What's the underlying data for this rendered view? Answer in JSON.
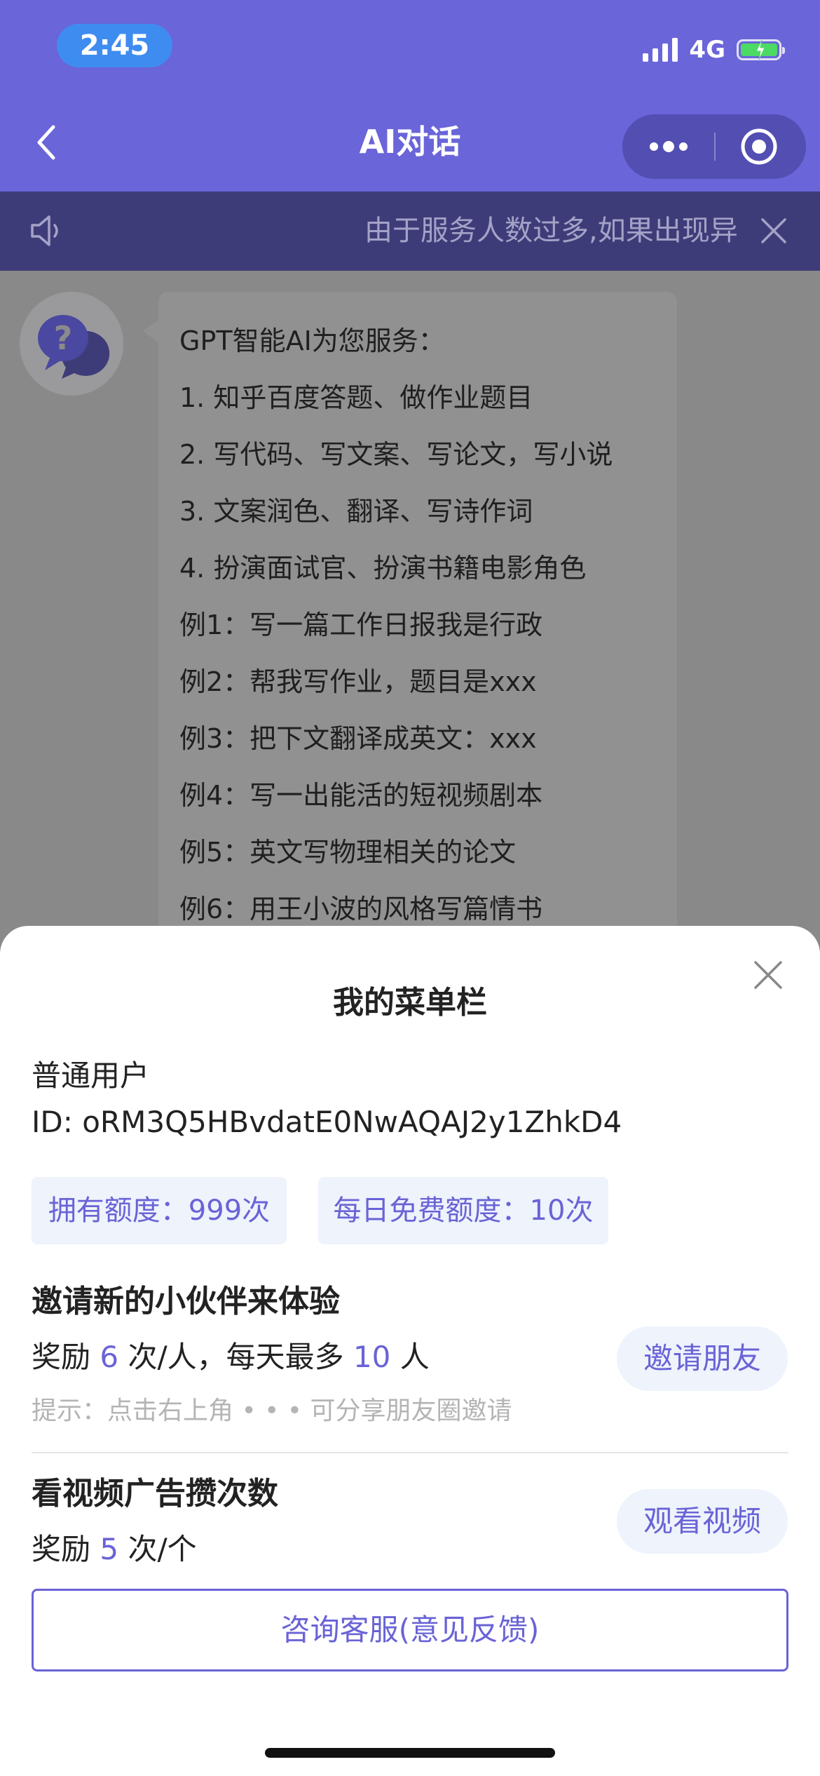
{
  "status_bar": {
    "time": "2:45",
    "network": "4G",
    "icons": [
      "signal-icon",
      "battery-charging-icon"
    ]
  },
  "navbar": {
    "title": "AI对话",
    "icons": [
      "back-icon",
      "more-icon",
      "target-icon"
    ]
  },
  "notice": {
    "text": "由于服务人数过多,如果出现异",
    "icons": [
      "speaker-icon",
      "close-icon"
    ]
  },
  "chat": {
    "messages": [
      {
        "sender": "bot",
        "avatar_icon": "question-chat-icon",
        "lines": [
          "GPT智能AI为您服务：",
          "1. 知乎百度答题、做作业题目",
          "2. 写代码、写文案、写论文，写小说",
          "3. 文案润色、翻译、写诗作词",
          "4. 扮演面试官、扮演书籍电影角色",
          "例1：写一篇工作日报我是行政",
          "例2：帮我写作业，题目是xxx",
          "例3：把下文翻译成英文：xxx",
          "例4：写一出能活的短视频剧本",
          "例5：英文写物理相关的论文",
          "例6：用王小波的风格写篇情书"
        ]
      }
    ]
  },
  "sheet": {
    "title": "我的菜单栏",
    "user_type": "普通用户",
    "user_id": "ID: oRM3Q5HBvdatE0NwAQAJ2y1ZhkD4",
    "quota_owned": "拥有额度：999次",
    "quota_daily": "每日免费额度：10次",
    "invite": {
      "title": "邀请新的小伙伴来体验",
      "reward_prefix": "奖励 ",
      "reward_per": "6",
      "reward_mid": " 次/人，每天最多 ",
      "reward_max": "10",
      "reward_suffix": " 人",
      "hint": "提示：点击右上角 • • • 可分享朋友圈邀请",
      "button": "邀请朋友"
    },
    "video": {
      "title": "看视频广告攒次数",
      "reward_prefix": "奖励 ",
      "reward_count": "5",
      "reward_suffix": " 次/个",
      "button": "观看视频"
    },
    "support_button": "咨询客服(意见反馈)"
  },
  "colors": {
    "header": "#6a65d9",
    "accent": "#6a63d6",
    "chip_bg": "#eef3fc",
    "notice_bg": "#3e3c78"
  }
}
